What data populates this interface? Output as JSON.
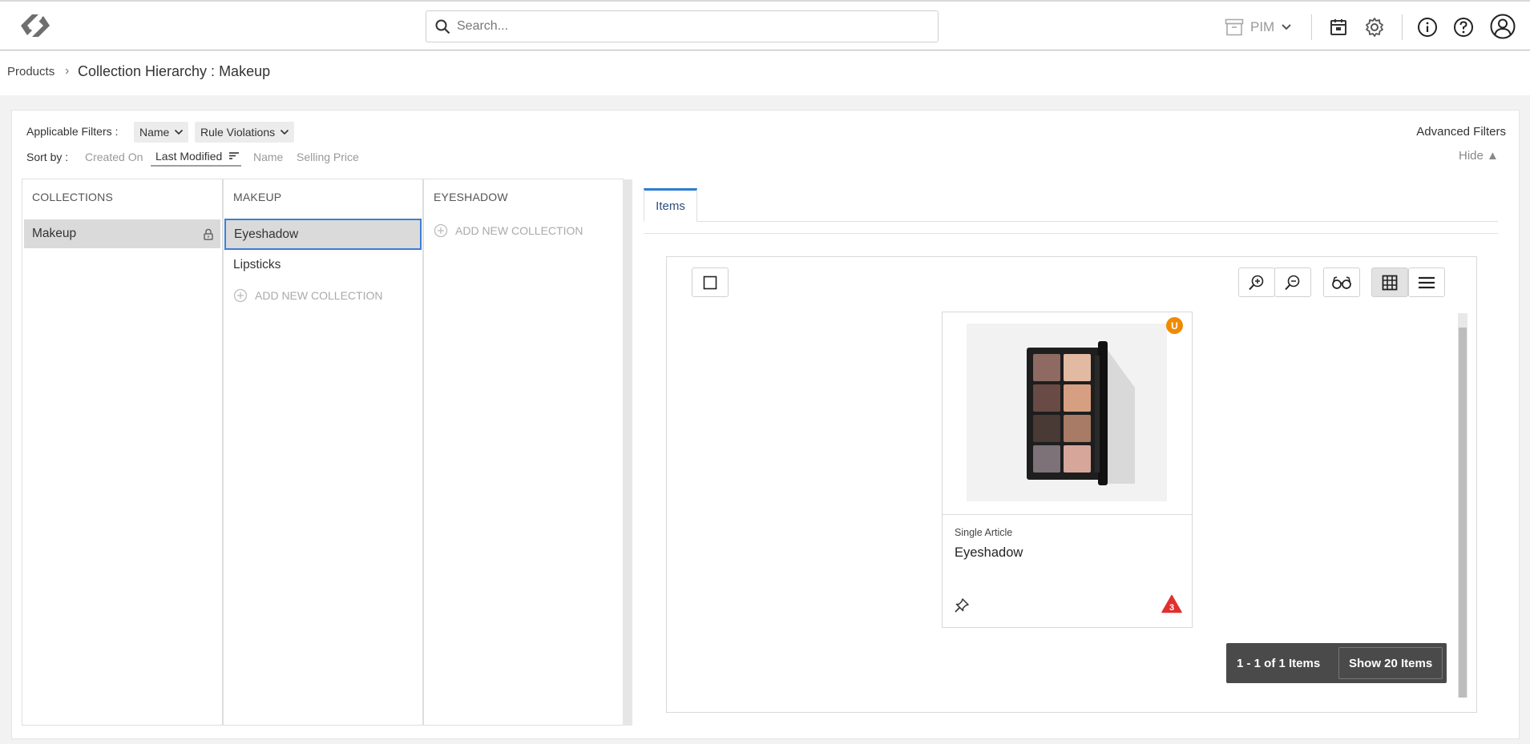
{
  "header": {
    "logo_icon": "diamond-link-logo-icon",
    "search_placeholder": "Search...",
    "module_label": "PIM",
    "icons": [
      "box-icon",
      "calendar-box-icon",
      "gear-icon",
      "info-icon",
      "help-icon",
      "user-avatar-icon"
    ]
  },
  "breadcrumb": {
    "root": "Products",
    "separator": "›",
    "title": "Collection Hierarchy : Makeup"
  },
  "filters": {
    "label": "Applicable Filters :",
    "chips": [
      "Name",
      "Rule Violations"
    ],
    "advanced": "Advanced Filters",
    "hide": "Hide ▲"
  },
  "sort": {
    "label": "Sort by :",
    "options": [
      "Created On",
      "Last Modified",
      "Name",
      "Selling Price"
    ],
    "active": "Last Modified"
  },
  "columns": [
    {
      "header": "COLLECTIONS",
      "items": [
        "Makeup"
      ],
      "selected": "Makeup",
      "locked": true
    },
    {
      "header": "MAKEUP",
      "items": [
        "Eyeshadow",
        "Lipsticks"
      ],
      "selected": "Eyeshadow",
      "add_label": "ADD NEW COLLECTION"
    },
    {
      "header": "EYESHADOW",
      "items": [],
      "add_label": "ADD NEW COLLECTION"
    }
  ],
  "tabs": [
    "Items"
  ],
  "grid": {
    "toolbar_icons": [
      "select-all-checkbox",
      "zoom-in-icon",
      "zoom-out-icon",
      "preview-glasses-icon",
      "grid-view-icon",
      "list-view-icon"
    ],
    "card": {
      "badge": "U",
      "type": "Single Article",
      "name": "Eyeshadow",
      "warning_count": "3"
    },
    "pager": {
      "count": "1 - 1 of 1 Items",
      "show": "Show 20 Items"
    }
  },
  "colors": {
    "accent_blue": "#2d7dd2",
    "badge_orange": "#f08a00",
    "warning_red": "#e03030",
    "pager_bg": "#4a4a4a"
  }
}
